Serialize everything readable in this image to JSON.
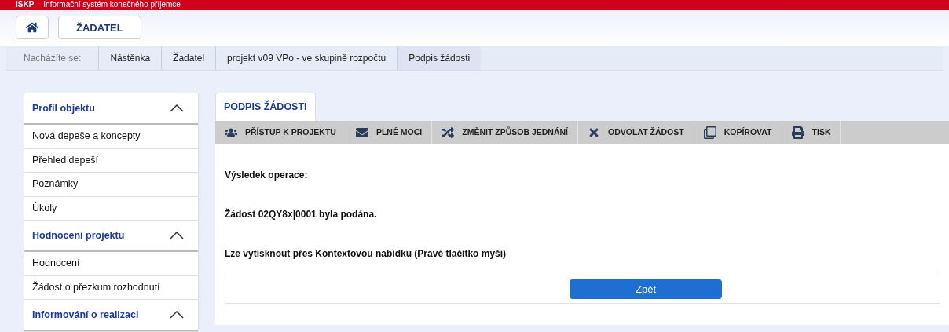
{
  "app_bar": {
    "short_name": "ISKP",
    "title": "Informační systém konečného příjemce"
  },
  "header": {
    "role_button": "ŽADATEL"
  },
  "breadcrumb": {
    "label": "Nacházíte se:",
    "items": [
      "Nástěnka",
      "Žadatel",
      "projekt v09 VPo - ve skupině rozpočtu",
      "Podpis žádosti"
    ]
  },
  "sidebar": [
    {
      "title": "Profil objektu",
      "expanded": true,
      "items": [
        "Nová depeše a koncepty",
        "Přehled depeší",
        "Poznámky",
        "Úkoly"
      ]
    },
    {
      "title": "Hodnocení projektu",
      "expanded": true,
      "items": [
        "Hodnocení",
        "Žádost o přezkum rozhodnutí"
      ]
    },
    {
      "title": "Informování o realizaci",
      "expanded": true
    }
  ],
  "tabs": [
    {
      "label": "PODPIS ŽÁDOSTI",
      "selected": true
    }
  ],
  "toolbar": [
    {
      "kind": "people",
      "label": "PŘÍSTUP K PROJEKTU"
    },
    {
      "kind": "mail",
      "label": "PLNÉ MOCI"
    },
    {
      "kind": "shuffle",
      "label": "ZMĚNIT ZPŮSOB JEDNÁNÍ"
    },
    {
      "kind": "cross",
      "label": "ODVOLAT ŽÁDOST"
    },
    {
      "kind": "copy",
      "label": "KOPÍROVAT"
    },
    {
      "kind": "print",
      "label": "TISK"
    }
  ],
  "messages": [
    "Výsledek operace:",
    "Žádost 02QY8x|0001 byla podána.",
    "Lze vytisknout přes Kontextovou nabídku (Pravé tlačítko myši)"
  ],
  "back_button": "Zpět"
}
